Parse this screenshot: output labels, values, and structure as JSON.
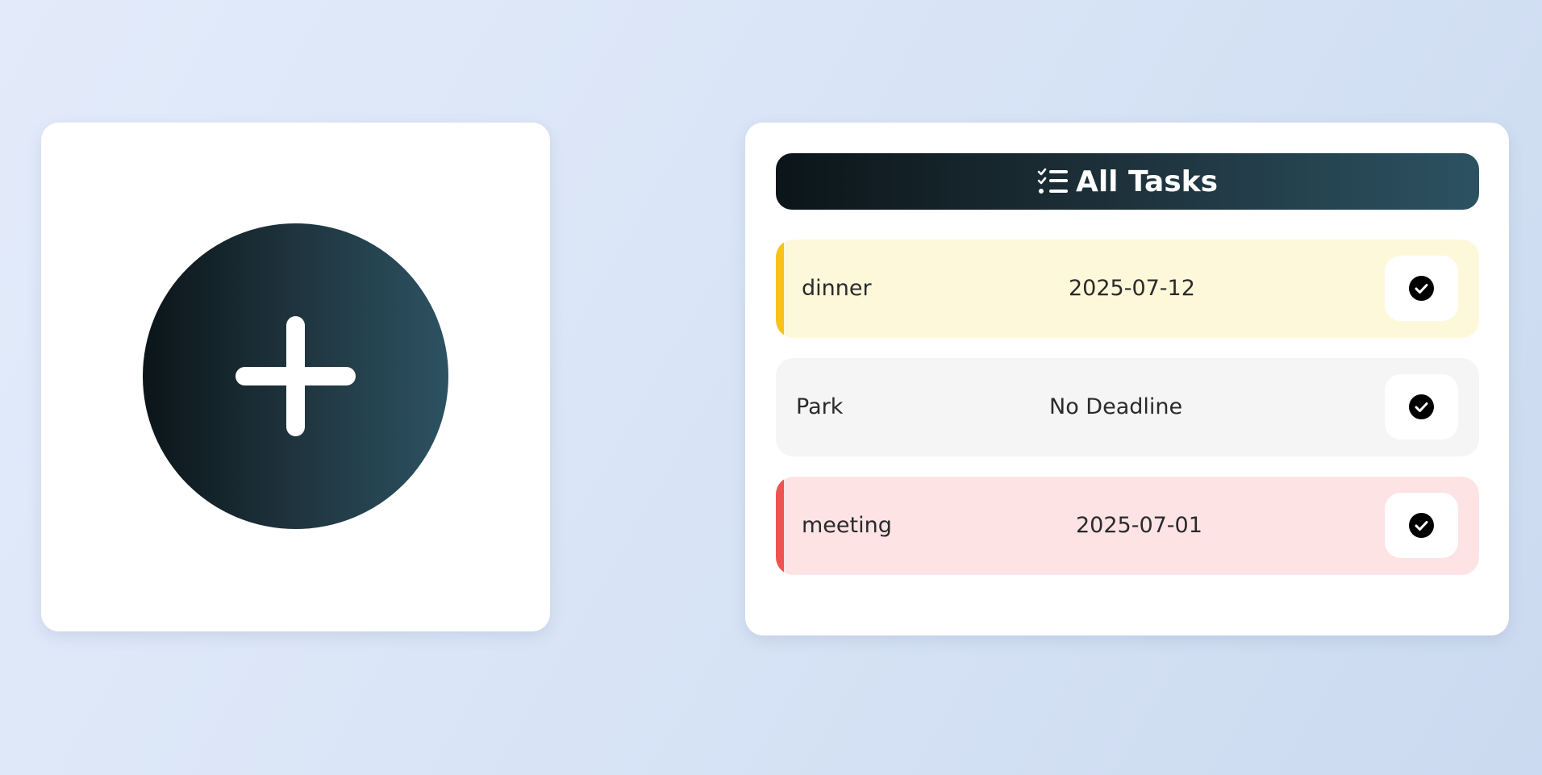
{
  "header": {
    "title": "All Tasks",
    "icon": "list-check-icon"
  },
  "add_button": {
    "icon": "plus-icon"
  },
  "tasks": [
    {
      "name": "dinner",
      "due": "2025-07-12",
      "accent_color": "#f8c21b",
      "background_color": "#fef8da",
      "action_icon": "check-circle-icon"
    },
    {
      "name": "Park",
      "due": "No Deadline",
      "accent_color": "",
      "background_color": "#f5f5f5",
      "action_icon": "check-circle-icon"
    },
    {
      "name": "meeting",
      "due": "2025-07-01",
      "accent_color": "#ef5350",
      "background_color": "#fee3e5",
      "action_icon": "check-circle-icon"
    }
  ],
  "colors": {
    "dark_gradient_start": "#0b1519",
    "dark_gradient_end": "#2c5262",
    "card_background": "#ffffff"
  }
}
